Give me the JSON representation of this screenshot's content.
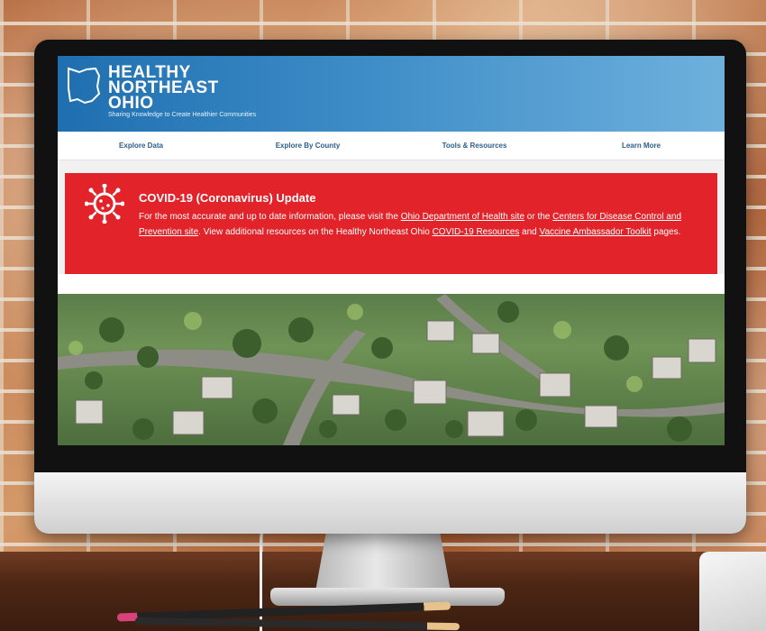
{
  "site": {
    "logo_text": "HEALTHY\nNORTHEAST\nOHIO",
    "tagline": "Sharing Knowledge to Create Healthier Communities"
  },
  "nav": {
    "items": [
      {
        "label": "Explore Data"
      },
      {
        "label": "Explore By County"
      },
      {
        "label": "Tools & Resources"
      },
      {
        "label": "Learn More"
      }
    ]
  },
  "alert": {
    "title": "COVID-19 (Coronavirus) Update",
    "text_1": "For the most accurate and up to date information, please visit the ",
    "link_1": "Ohio Department of Health site",
    "text_2": " or the ",
    "link_2": "Centers for Disease Control and Prevention site",
    "text_3": ". View additional resources on the Healthy Northeast Ohio ",
    "link_3": "COVID-19 Resources",
    "text_4": " and ",
    "link_4": "Vaccine Ambassador Toolkit",
    "text_5": " pages."
  },
  "icons": {
    "virus": "coronavirus-icon",
    "logo": "ohio-map-icon"
  },
  "colors": {
    "header_blue": "#1f6fb0",
    "alert_red": "#e2232a",
    "nav_text": "#2b5f8e"
  }
}
